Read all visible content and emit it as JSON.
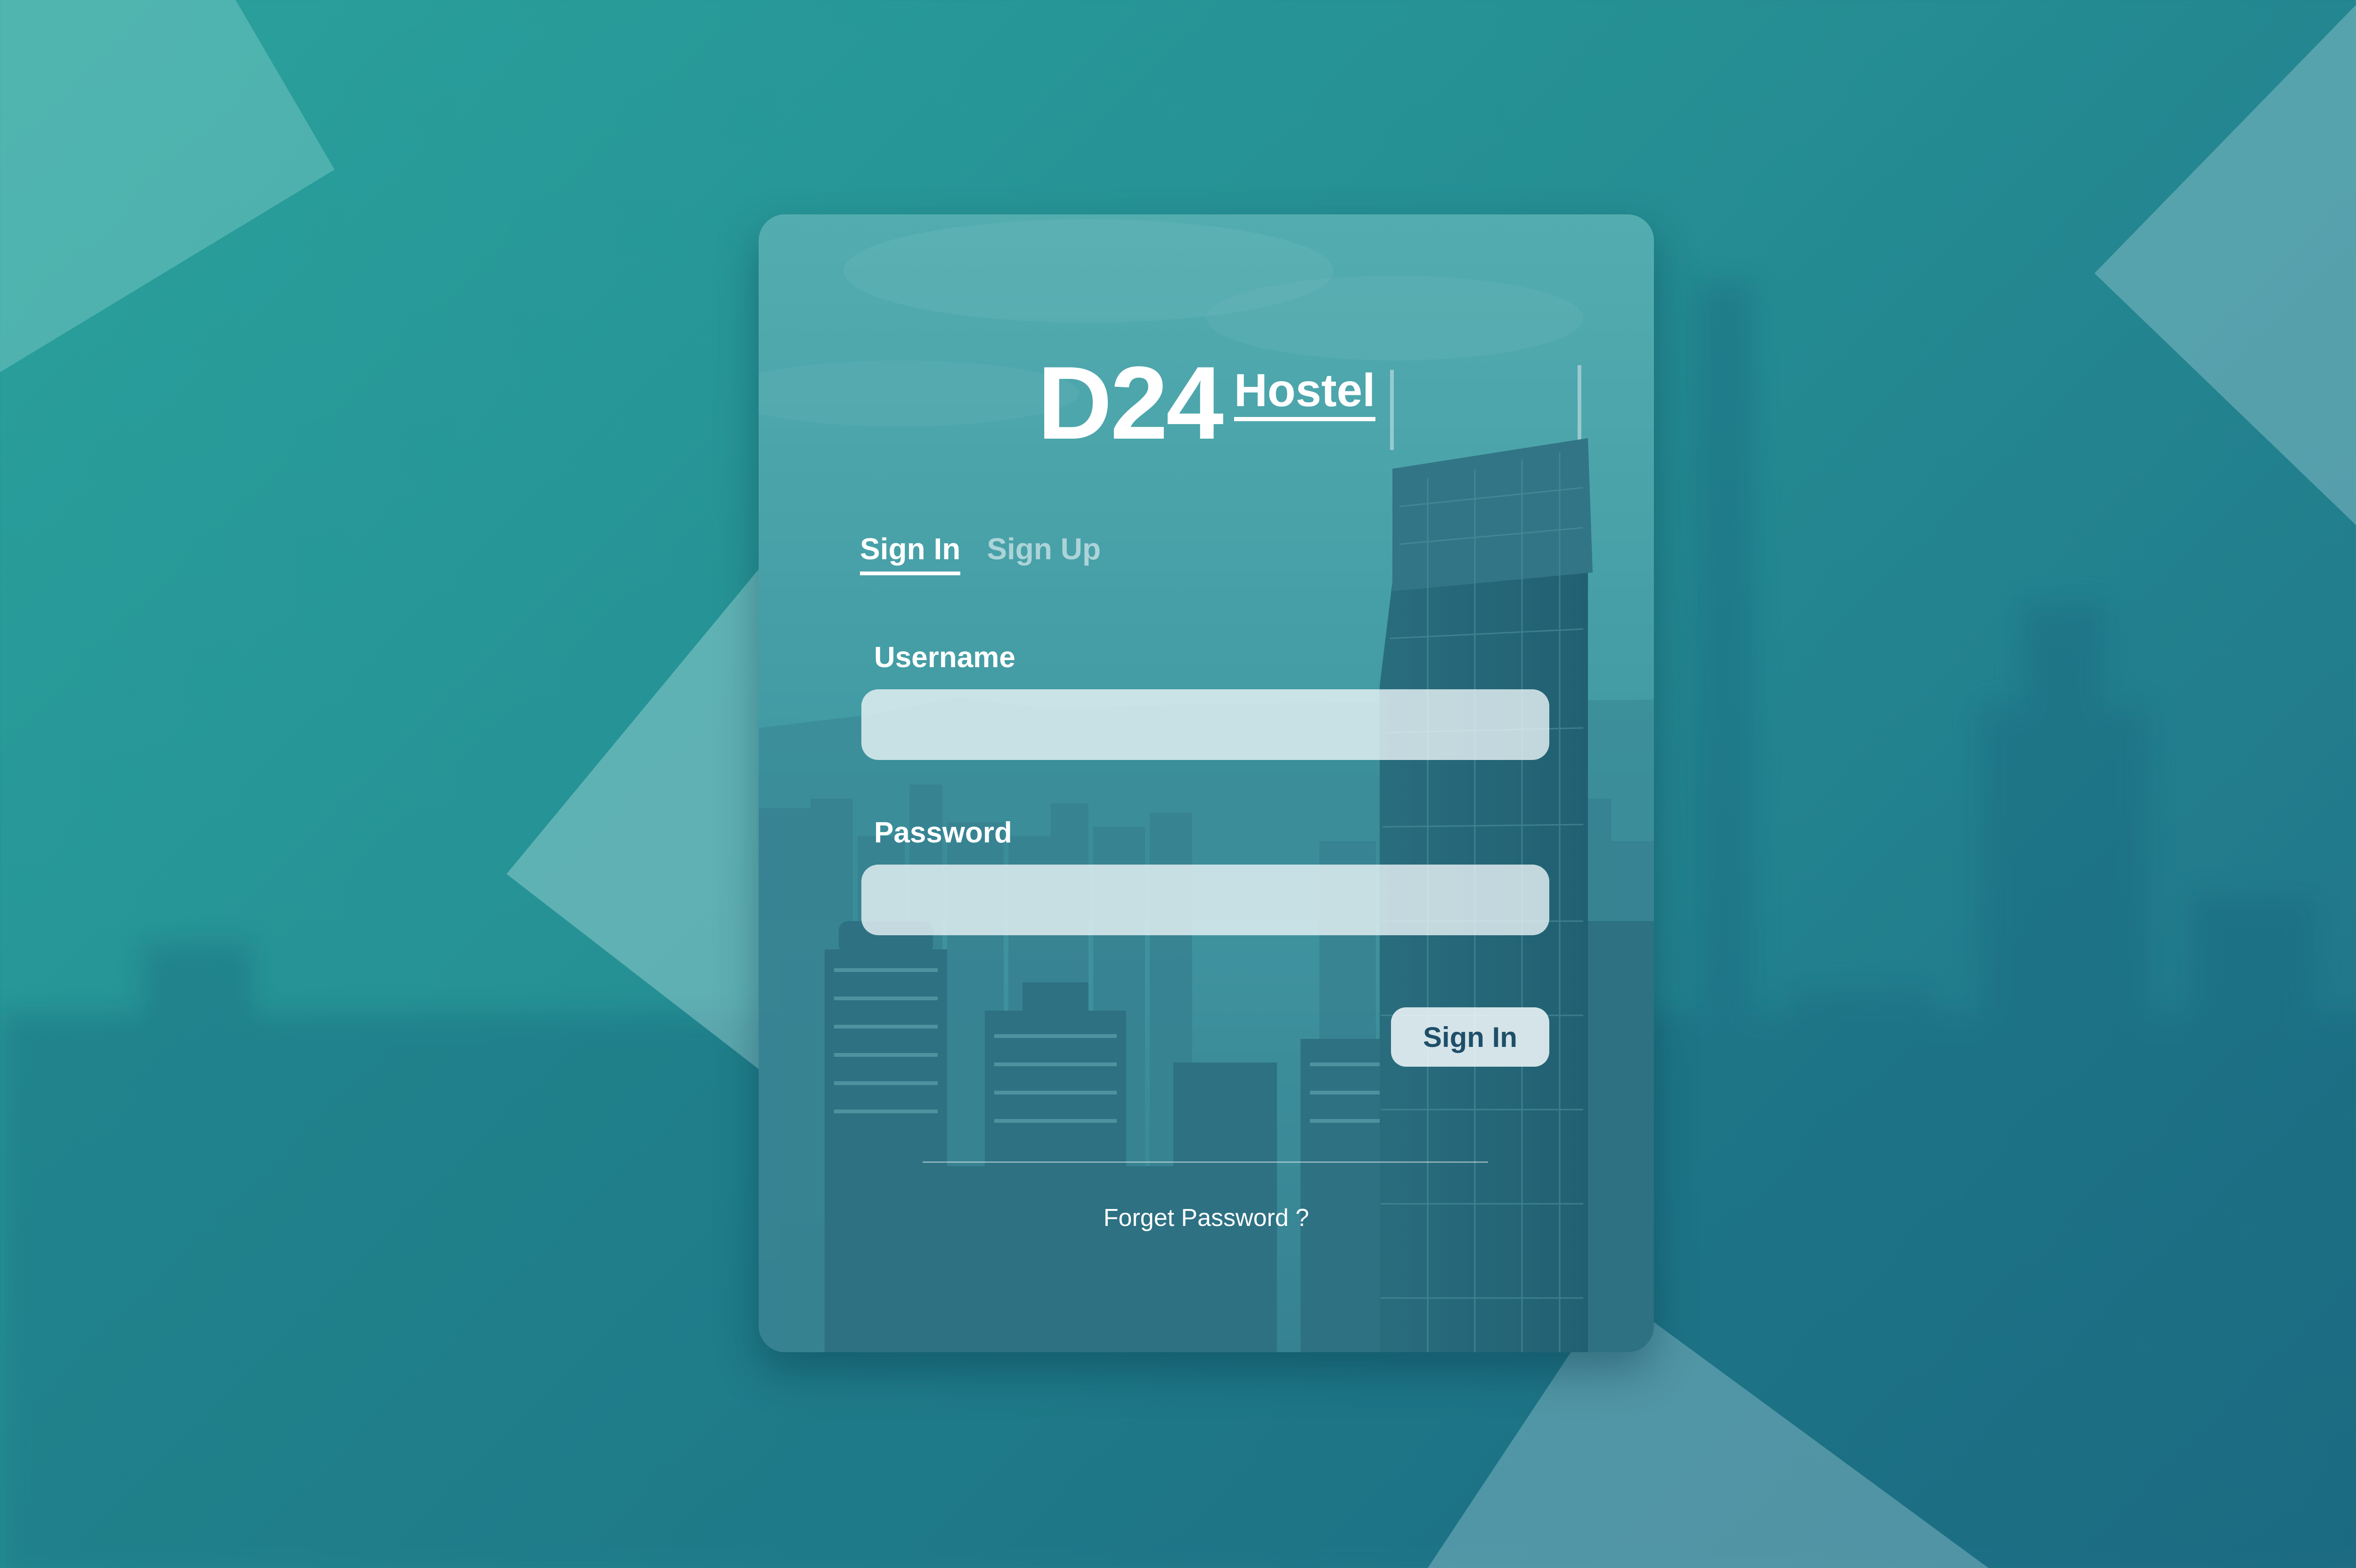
{
  "brand": {
    "main": "D24",
    "sub": "Hostel"
  },
  "tabs": [
    {
      "label": "Sign In",
      "active": true
    },
    {
      "label": "Sign Up",
      "active": false
    }
  ],
  "form": {
    "username_label": "Username",
    "username_value": "",
    "password_label": "Password",
    "password_value": "",
    "submit_label": "Sign In"
  },
  "links": {
    "forget_password": "Forget Password ?"
  },
  "colors": {
    "background_start": "#2aa19c",
    "background_end": "#1f6f86",
    "card_overlay": "#3f8f9c",
    "input_fill": "#ebf5f7",
    "button_text": "#1f4f68"
  }
}
